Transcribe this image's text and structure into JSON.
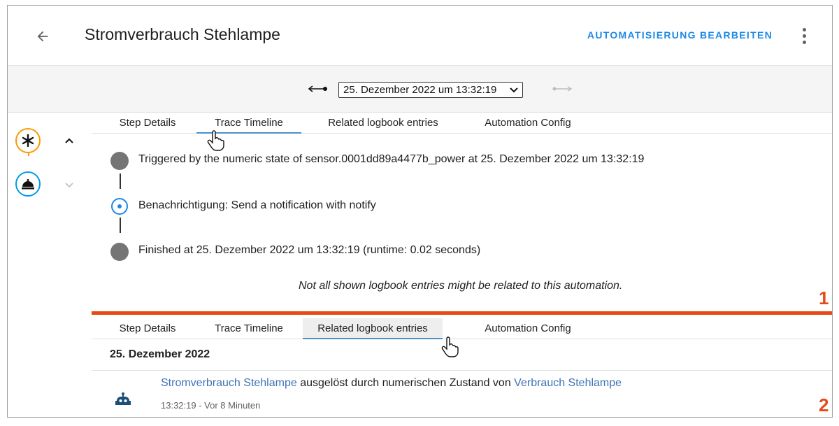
{
  "header": {
    "title": "Stromverbrauch Stehlampe",
    "edit_label": "AUTOMATISIERUNG BEARBEITEN"
  },
  "toolbar": {
    "selected_trace": "25. Dezember 2022 um 13:32:19"
  },
  "tabs_top": {
    "items": [
      "Step Details",
      "Trace Timeline",
      "Related logbook entries",
      "Automation Config"
    ],
    "active": "Trace Timeline"
  },
  "timeline": {
    "trigger": "Triggered by the numeric state of sensor.0001dd89a4477b_power at 25. Dezember 2022 um 13:32:19",
    "action": "Benachrichtigung: Send a notification with notify",
    "finished": "Finished at 25. Dezember 2022 um 13:32:19 (runtime: 0.02 seconds)",
    "note": "Not all shown logbook entries might be related to this automation."
  },
  "markers": {
    "first": "1",
    "second": "2"
  },
  "tabs_bottom": {
    "items": [
      "Step Details",
      "Trace Timeline",
      "Related logbook entries",
      "Automation Config"
    ],
    "active": "Related logbook entries"
  },
  "logbook": {
    "date": "25. Dezember 2022",
    "entry": {
      "name": "Stromverbrauch Stehlampe",
      "middle": " ausgelöst durch numerischen Zustand von ",
      "source": "Verbrauch Stehlampe",
      "time": "13:32:19 - Vor 8 Minuten"
    }
  },
  "icons": {
    "back": "arrow-left-icon",
    "more": "dots-vertical-icon",
    "trigger_node": "asterisk-icon",
    "action_node": "bell-icon",
    "entry": "robot-icon",
    "cursor": "hand-pointer-icon"
  },
  "colors": {
    "accent": "#1e88e5",
    "trigger_node": "#ff9800",
    "action_node": "#039be5",
    "divider": "#e64a19",
    "link": "#3f73b4"
  }
}
